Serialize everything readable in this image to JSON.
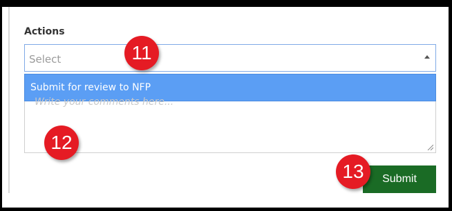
{
  "form": {
    "actions_label": "Actions",
    "select": {
      "value": "Select",
      "caret_icon": "caret-up-icon"
    },
    "dropdown_options": [
      "Submit for review to NFP"
    ],
    "comments": {
      "placeholder": "Write your comments here..."
    },
    "submit_label": "Submit"
  },
  "annotations": {
    "step_select": "11",
    "step_comments": "12",
    "step_submit": "13"
  },
  "colors": {
    "option_highlight": "#5b9ef4",
    "submit_button": "#1a6b25",
    "badge": "#e51b24"
  }
}
